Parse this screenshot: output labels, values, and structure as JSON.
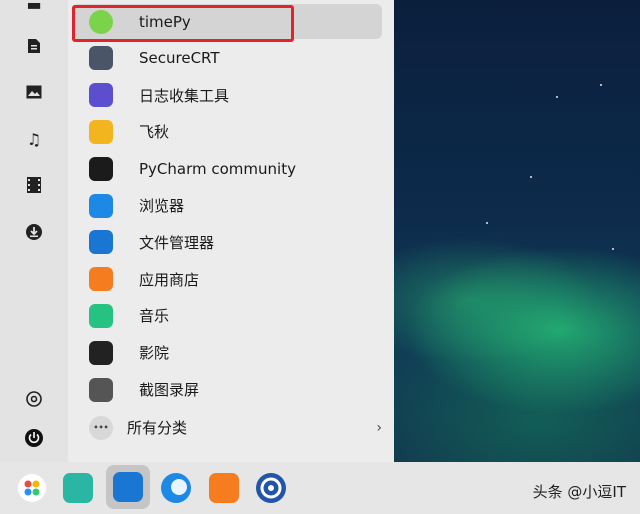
{
  "side_rail": {
    "icons": [
      "document-icon",
      "image-icon",
      "music-icon",
      "video-icon",
      "download-icon"
    ],
    "bottom_icons": [
      "settings-icon",
      "power-icon"
    ]
  },
  "apps": [
    {
      "label": "timePy",
      "icon": "timepy-icon",
      "color": "#7bd34b"
    },
    {
      "label": "SecureCRT",
      "icon": "securecrt-icon",
      "color": "#4a5568"
    },
    {
      "label": "日志收集工具",
      "icon": "log-collector-icon",
      "color": "#5b4fcf"
    },
    {
      "label": "飞秋",
      "icon": "feiq-icon",
      "color": "#f2b51f"
    },
    {
      "label": "PyCharm community",
      "icon": "pycharm-icon",
      "color": "#1b1b1b"
    },
    {
      "label": "浏览器",
      "icon": "browser-icon",
      "color": "#1e88e5"
    },
    {
      "label": "文件管理器",
      "icon": "file-manager-icon",
      "color": "#1976d2"
    },
    {
      "label": "应用商店",
      "icon": "app-store-icon",
      "color": "#f57c1f"
    },
    {
      "label": "音乐",
      "icon": "music-app-icon",
      "color": "#26c281"
    },
    {
      "label": "影院",
      "icon": "movie-icon",
      "color": "#222222"
    },
    {
      "label": "截图录屏",
      "icon": "screenshot-icon",
      "color": "#555555"
    }
  ],
  "all_categories": {
    "label": "所有分类",
    "icon": "more-icon"
  },
  "taskbar": {
    "items": [
      {
        "name": "launcher-icon",
        "color": "#ffffff"
      },
      {
        "name": "multitask-view-icon",
        "color": "#2bb5a3"
      },
      {
        "name": "file-manager-taskbar-icon",
        "color": "#1976d2"
      },
      {
        "name": "browser-taskbar-icon",
        "color": "#1e88e5"
      },
      {
        "name": "app-store-taskbar-icon",
        "color": "#f57c1f"
      },
      {
        "name": "control-center-icon",
        "color": "#2255aa"
      }
    ]
  },
  "watermark": "头条 @小逗IT",
  "accent": {
    "highlight": "#e0242a"
  }
}
